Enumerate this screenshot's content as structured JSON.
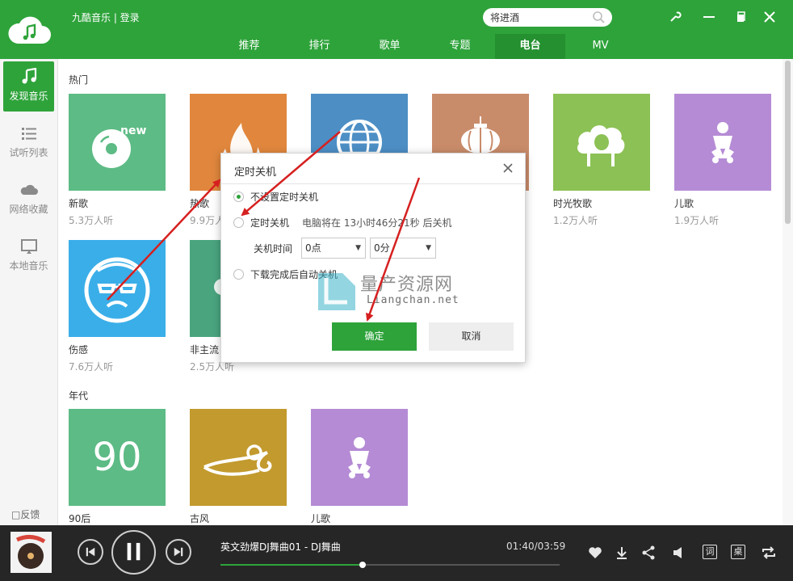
{
  "app": {
    "title": "九酷音乐 | 登录",
    "search_value": "将进酒",
    "nav_tabs": [
      {
        "label": "推荐"
      },
      {
        "label": "排行"
      },
      {
        "label": "歌单"
      },
      {
        "label": "专题"
      },
      {
        "label": "电台",
        "active": true
      },
      {
        "label": "MV"
      }
    ]
  },
  "sidebar": {
    "items": [
      {
        "label": "发现音乐",
        "icon": "music-note-icon",
        "active": true
      },
      {
        "label": "试听列表",
        "icon": "list-icon"
      },
      {
        "label": "网络收藏",
        "icon": "cloud-icon"
      },
      {
        "label": "本地音乐",
        "icon": "monitor-icon"
      }
    ],
    "feedback": "反馈"
  },
  "content": {
    "sections": [
      {
        "title": "热门",
        "cards": [
          {
            "name": "新歌",
            "listeners": "5.3万人听",
            "icon": "new-disc-icon",
            "color": "#5dbb85"
          },
          {
            "name": "热歌",
            "listeners": "9.9万人听",
            "icon": "flame-icon",
            "color": "#e1873d"
          },
          {
            "name": "",
            "listeners": "",
            "icon": "globe-icon",
            "color": "#4d8fc5"
          },
          {
            "name": "",
            "listeners": "",
            "icon": "lantern-icon",
            "color": "#c98c6a"
          },
          {
            "name": "时光牧歌",
            "listeners": "1.2万人听",
            "icon": "sheep-icon",
            "color": "#8cc155"
          },
          {
            "name": "儿歌",
            "listeners": "1.9万人听",
            "icon": "baby-icon",
            "color": "#b58bd5"
          },
          {
            "name": "伤感",
            "listeners": "7.6万人听",
            "icon": "sad-face-icon",
            "color": "#3aaee8"
          },
          {
            "name": "非主流",
            "listeners": "2.5万人听",
            "icon": "nonmainstream-icon",
            "color": "#4aa57f"
          }
        ]
      },
      {
        "title": "年代",
        "cards": [
          {
            "name": "90后",
            "listeners": "",
            "overlay_text": "90",
            "color": "#5dbb85"
          },
          {
            "name": "古风",
            "listeners": "",
            "icon": "cloud-pattern-icon",
            "color": "#c29a2e"
          },
          {
            "name": "儿歌",
            "listeners": "",
            "icon": "baby-icon",
            "color": "#b58bd5"
          }
        ]
      }
    ]
  },
  "dialog": {
    "title": "定时关机",
    "options": [
      {
        "label": "不设置定时关机",
        "checked": true
      },
      {
        "label": "定时关机",
        "checked": false,
        "countdown": "电脑将在 13小时46分21秒 后关机"
      },
      {
        "label": "下载完成后自动关机",
        "checked": false
      }
    ],
    "shutdown_time_label": "关机时间",
    "hour_value": "0点",
    "minute_value": "0分",
    "ok_label": "确定",
    "cancel_label": "取消"
  },
  "watermark": {
    "text": "量产资源网",
    "sub": "Liangchan.net"
  },
  "player": {
    "track_title": "英文劲爆DJ舞曲01 - DJ舞曲",
    "time": "01:40/03:59",
    "progress": 0.42,
    "lyrics_label": "词",
    "desktop_label": "桌"
  },
  "colors": {
    "brand": "#2ea33a",
    "brand_dark": "#24902f",
    "player_bg": "#262626",
    "arrow": "#d62020"
  }
}
